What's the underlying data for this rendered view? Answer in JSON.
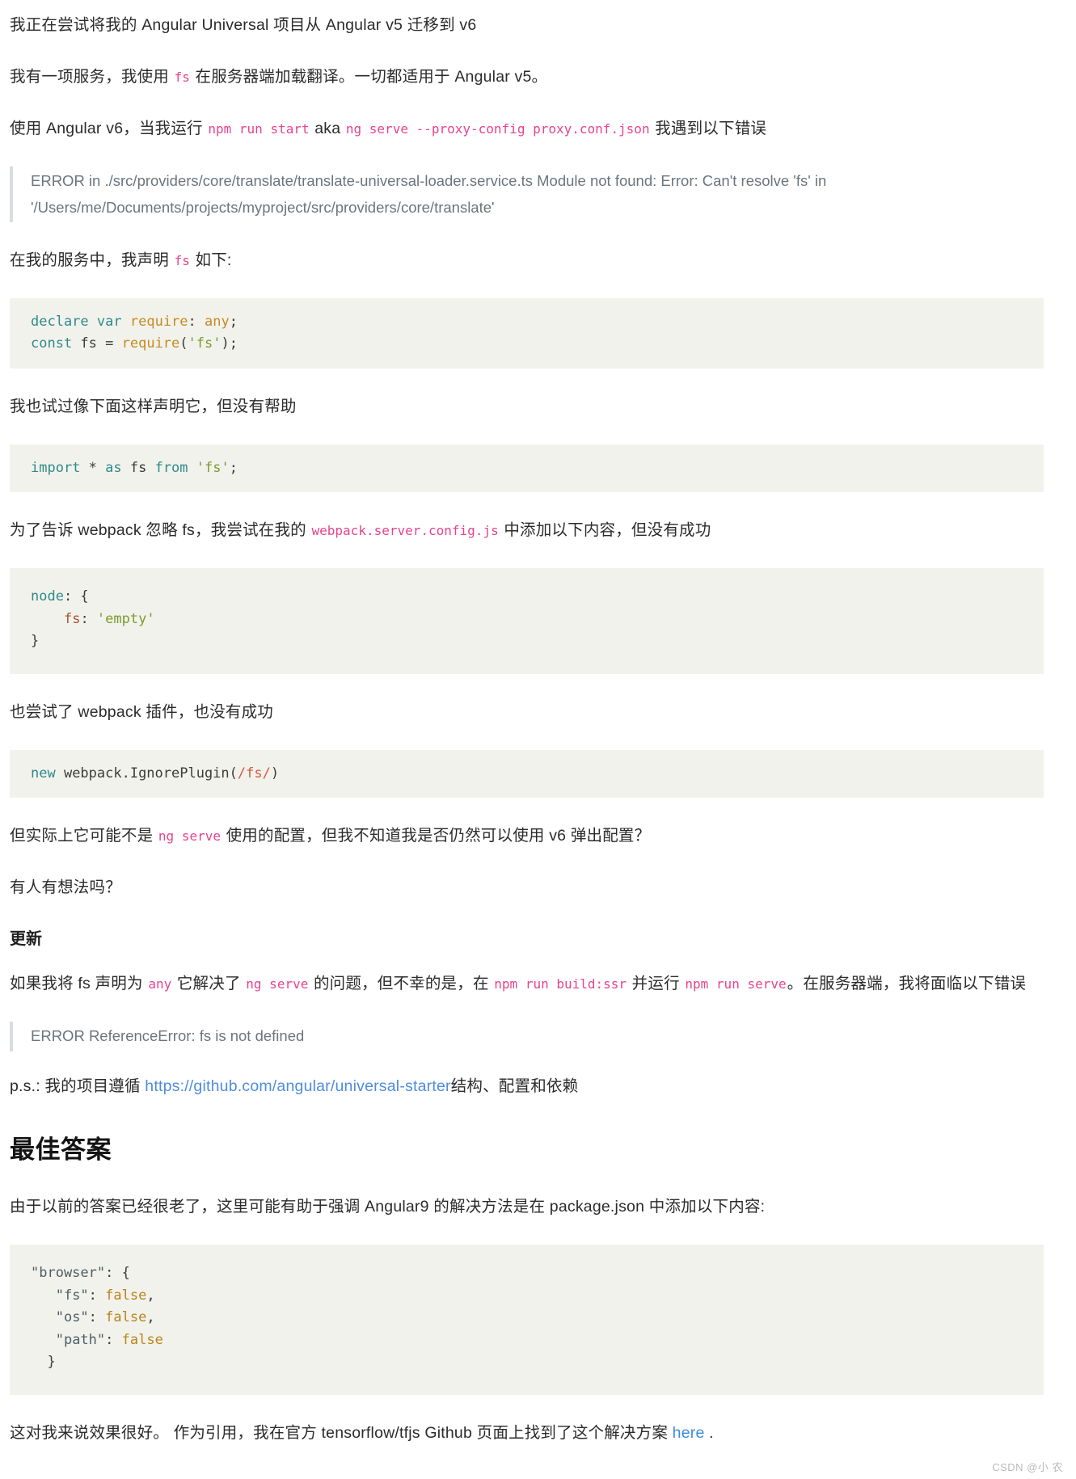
{
  "paragraphs": {
    "p1": "我正在尝试将我的 Angular Universal 项目从 Angular v5 迁移到 v6",
    "p2_a": "我有一项服务，我使用 ",
    "p2_code": "fs",
    "p2_b": " 在服务器端加载翻译。一切都适用于 Angular v5。",
    "p3_a": "使用 Angular v6，当我运行 ",
    "p3_code1": "npm run start",
    "p3_mid": " aka ",
    "p3_code2": "ng serve --proxy-config proxy.conf.json",
    "p3_b": " 我遇到以下错误",
    "p4_a": "在我的服务中，我声明 ",
    "p4_code": "fs",
    "p4_b": " 如下:",
    "p5": "我也试过像下面这样声明它，但没有帮助",
    "p6_a": "为了告诉 webpack 忽略 fs，我尝试在我的 ",
    "p6_code": "webpack.server.config.js",
    "p6_b": " 中添加以下内容，但没有成功",
    "p7": "也尝试了 webpack 插件，也没有成功",
    "p8_a": "但实际上它可能不是 ",
    "p8_code": "ng serve",
    "p8_b": " 使用的配置，但我不知道我是否仍然可以使用 v6 弹出配置？",
    "p9": "有人有想法吗？",
    "p10_a": "如果我将 fs 声明为 ",
    "p10_code1": "any",
    "p10_b": " 它解决了 ",
    "p10_code2": "ng serve",
    "p10_c": " 的问题，但不幸的是，在 ",
    "p10_code3": "npm run build:ssr",
    "p10_d": " 并运行 ",
    "p10_code4": "npm run serve",
    "p10_e": "。在服务器端，我将面临以下错误",
    "p11_a": "p.s.: 我的项目遵循 ",
    "p11_link": "https://github.com/angular/universal-starter",
    "p11_b": "结构、配置和依赖",
    "p12": "由于以前的答案已经很老了，这里可能有助于强调 Angular9 的解决方法是在 package.json 中添加以下内容:",
    "p13_a": "这对我来说效果很好。 作为引用，我在官方 tensorflow/tfjs Github 页面上找到了这个解决方案 ",
    "p13_link": "here",
    "p13_b": " ."
  },
  "quotes": {
    "error_block_line1": "ERROR in ./src/providers/core/translate/translate-universal-loader.service.ts Module not found: Error: Can't resolve 'fs'",
    "error_block_line2": "in '/Users/me/Documents/projects/myproject/src/providers/core/translate'",
    "error_reference": "ERROR ReferenceError: fs is not defined"
  },
  "headings": {
    "update": "更新",
    "best_answer": "最佳答案"
  },
  "code_blocks": {
    "declare": {
      "line1": {
        "kw1": "declare",
        "kw2": "var",
        "fn": "require",
        "colon": ": ",
        "type": "any",
        "semi": ";"
      },
      "line2": {
        "kw": "const",
        "name": " fs ",
        "eq": "= ",
        "fn": "require",
        "open": "(",
        "str": "'fs'",
        "close": ");"
      }
    },
    "import": {
      "kw1": "import",
      "star": " * ",
      "kw2": "as",
      "name": " fs ",
      "kw3": "from",
      "str": " 'fs'",
      "semi": ";"
    },
    "node": {
      "line1_key": "node",
      "line1_rest": ": {",
      "line2_key": "fs",
      "line2_sep": ": ",
      "line2_val": "'empty'",
      "line3": "}"
    },
    "ignore_plugin": {
      "kw": "new",
      "name": " webpack.IgnorePlugin",
      "open": "(",
      "rx": "/fs/",
      "close": ")"
    },
    "browser_json": {
      "line1_key": "\"browser\"",
      "line1_rest": ": {",
      "line2_key": "\"fs\"",
      "line2_sep": ": ",
      "line2_val": "false",
      "line2_end": ",",
      "line3_key": "\"os\"",
      "line3_sep": ": ",
      "line3_val": "false",
      "line3_end": ",",
      "line4_key": "\"path\"",
      "line4_sep": ": ",
      "line4_val": "false",
      "line5": "}"
    }
  },
  "watermark": "CSDN @小 农",
  "colors": {
    "inline_code": "#e8438f",
    "link": "#4f8ce0",
    "code_bg": "#f2f2ec",
    "quote_border": "#d9dde1",
    "quote_text": "#6c757d"
  }
}
